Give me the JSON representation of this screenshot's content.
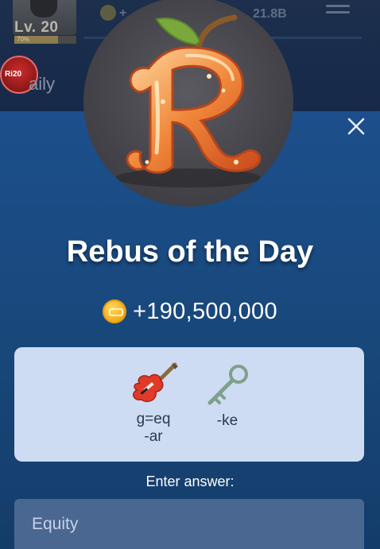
{
  "background_header": {
    "level_label": "Lv. 20",
    "level_progress_label": "70%",
    "level_progress": 0.7,
    "balance_prefix": "+",
    "balance_amount": "21.8B",
    "daily_badge_text": "Ri20",
    "daily_label": "aily"
  },
  "modal": {
    "hero_icon": "apple-letter-r-icon",
    "close_icon": "close-icon",
    "title": "Rebus of the Day",
    "reward": {
      "icon": "coin-icon",
      "amount": "+190,500,000"
    },
    "rebus": {
      "clues": [
        {
          "icon": "electric-guitar-icon",
          "line1": "g=eq",
          "line2": "-ar"
        },
        {
          "icon": "key-icon",
          "line1": "-ke",
          "line2": ""
        }
      ]
    },
    "answer_label": "Enter answer:",
    "answer_value": "Equity"
  },
  "colors": {
    "modal_bg": "#1c4f8c",
    "card_bg": "#cddcf3",
    "input_bg": "#4a6791",
    "coin": "#f2ac1a"
  }
}
